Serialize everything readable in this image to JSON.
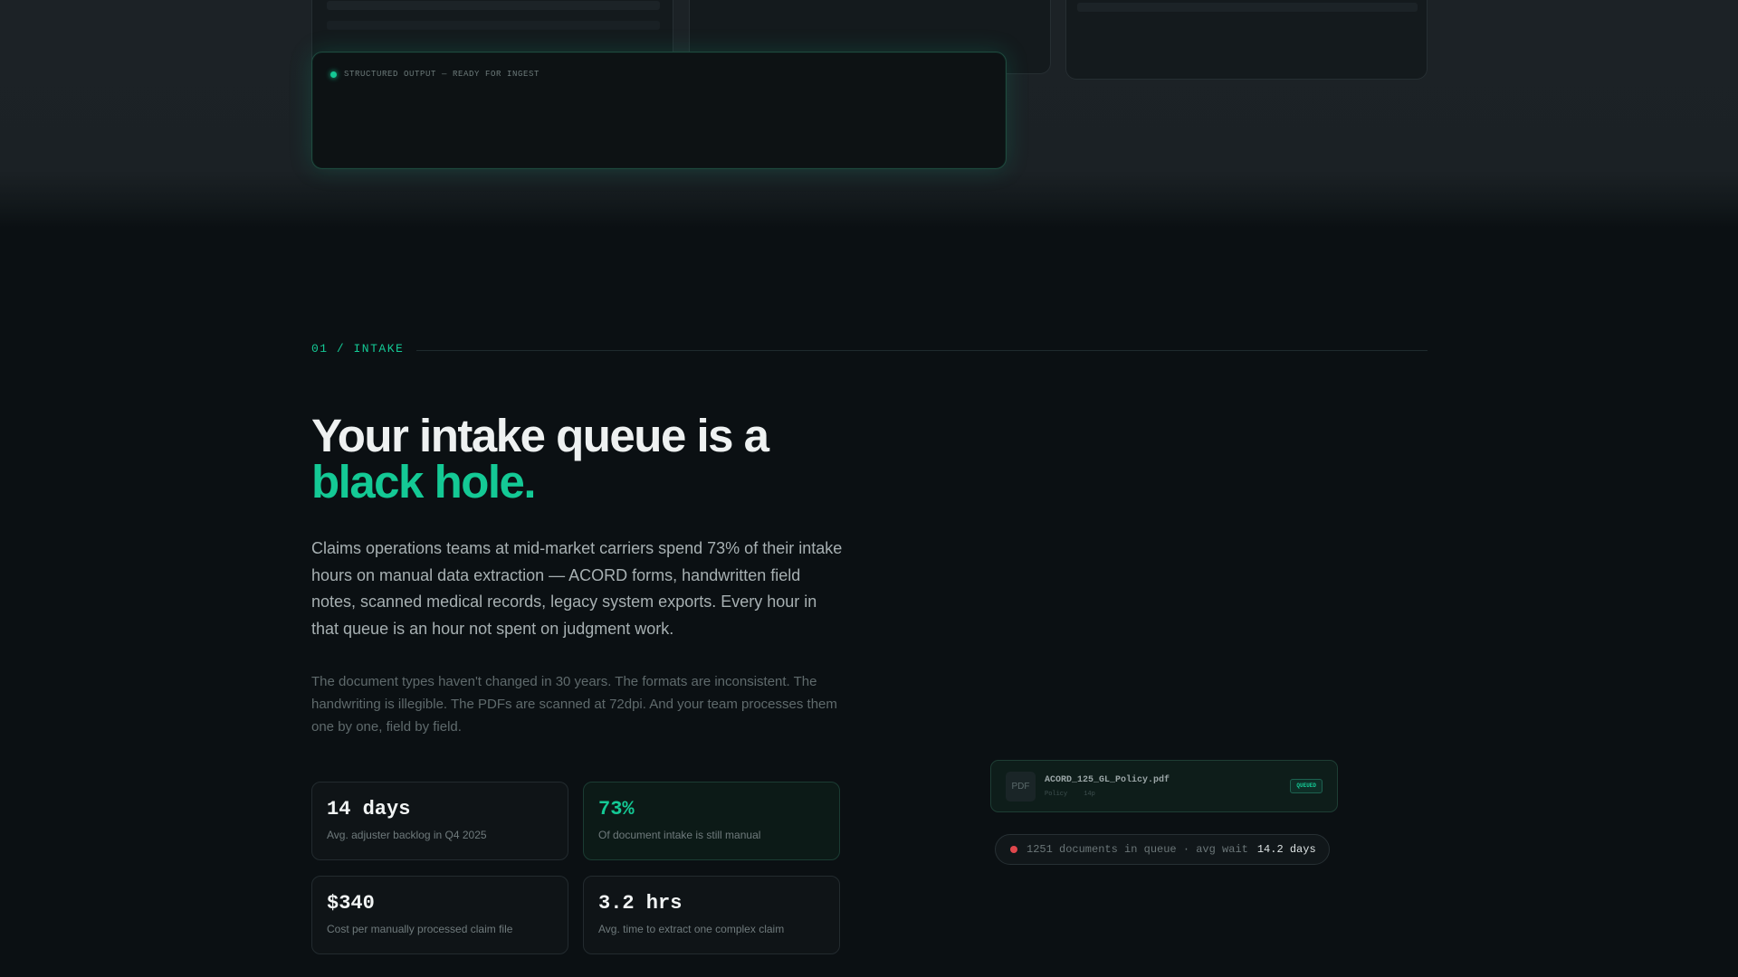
{
  "top": {
    "output_status": "STRUCTURED OUTPUT — READY FOR INGEST"
  },
  "section": {
    "tag": "01 / INTAKE"
  },
  "headline": {
    "line1": "Your intake queue is a",
    "line2": "black hole."
  },
  "lead": "Claims operations teams at mid-market carriers spend 73% of their intake hours on manual data extraction — ACORD forms, handwritten field notes, scanned medical records, legacy system exports. Every hour in that queue is an hour not spent on judgment work.",
  "sub": "The document types haven't changed in 30 years. The formats are inconsistent. The handwriting is illegible. The PDFs are scanned at 72dpi. And your team processes them one by one, field by field.",
  "stats": [
    {
      "value": "14 days",
      "label": "Avg. adjuster backlog in Q4 2025"
    },
    {
      "value": "73%",
      "label": "Of document intake is still manual"
    },
    {
      "value": "$340",
      "label": "Cost per manually processed claim file"
    },
    {
      "value": "3.2 hrs",
      "label": "Avg. time to extract one complex claim"
    }
  ],
  "queue": {
    "file_type": "PDF",
    "file_name": "ACORD_125_GL_Policy.pdf",
    "meta_type": "Policy",
    "meta_age": "14p",
    "badge": "QUEUED",
    "status_prefix": "1251 documents in queue · avg wait",
    "status_wait": "14.2 days"
  },
  "colors": {
    "accent": "#14c995",
    "alert": "#e0474c",
    "background": "#0b1013"
  }
}
